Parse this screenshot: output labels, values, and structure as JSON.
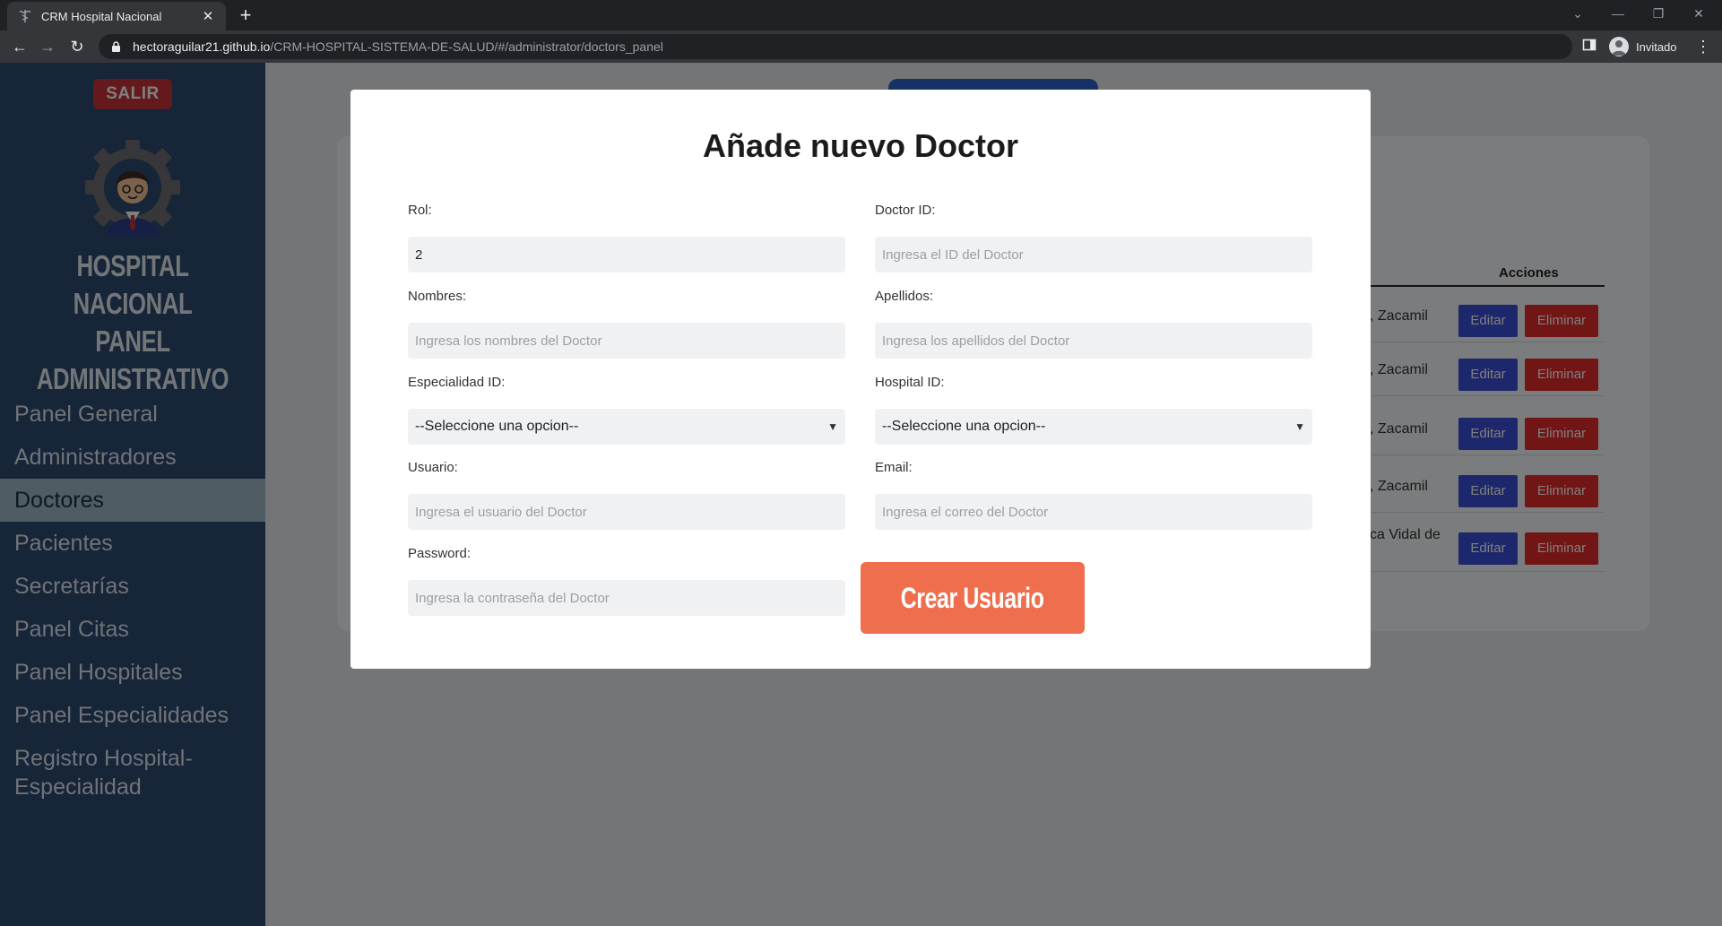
{
  "browser": {
    "tab_title": "CRM Hospital Nacional",
    "url_host": "hectoraguilar21.github.io",
    "url_path": "/CRM-HOSPITAL-SISTEMA-DE-SALUD/#/administrator/doctors_panel",
    "profile_label": "Invitado"
  },
  "sidebar": {
    "logout_label": "SALIR",
    "brand_line1": "HOSPITAL NACIONAL",
    "brand_line2": "PANEL",
    "brand_line3": "ADMINISTRATIVO",
    "items": [
      {
        "label": "Panel General"
      },
      {
        "label": "Administradores"
      },
      {
        "label": "Doctores"
      },
      {
        "label": "Pacientes"
      },
      {
        "label": "Secretarías"
      },
      {
        "label": "Panel Citas"
      },
      {
        "label": "Panel Hospitales"
      },
      {
        "label": "Panel Especialidades"
      },
      {
        "label": "Registro Hospital-Especialidad"
      }
    ]
  },
  "table": {
    "actions_header": "Acciones",
    "rows": [
      {
        "text": ", Zacamil",
        "edit": "Editar",
        "delete": "Eliminar"
      },
      {
        "text": ", Zacamil",
        "edit": "Editar",
        "delete": "Eliminar"
      },
      {
        "text": ", Zacamil",
        "edit": "Editar",
        "delete": "Eliminar"
      },
      {
        "text": ", Zacamil",
        "edit": "Editar",
        "delete": "Eliminar"
      },
      {
        "text": "ca Vidal de",
        "edit": "Editar",
        "delete": "Eliminar"
      }
    ]
  },
  "modal": {
    "title": "Añade nuevo Doctor",
    "fields": {
      "rol": {
        "label": "Rol:",
        "value": "2"
      },
      "doctor_id": {
        "label": "Doctor ID:",
        "placeholder": "Ingresa el ID del Doctor"
      },
      "nombres": {
        "label": "Nombres:",
        "placeholder": "Ingresa los nombres del Doctor"
      },
      "apellidos": {
        "label": "Apellidos:",
        "placeholder": "Ingresa los apellidos del Doctor"
      },
      "especialidad": {
        "label": "Especialidad ID:",
        "selected": "--Seleccione una opcion--"
      },
      "hospital": {
        "label": "Hospital ID:",
        "selected": "--Seleccione una opcion--"
      },
      "usuario": {
        "label": "Usuario:",
        "placeholder": "Ingresa el usuario del Doctor"
      },
      "email": {
        "label": "Email:",
        "placeholder": "Ingresa el correo del Doctor"
      },
      "password": {
        "label": "Password:",
        "placeholder": "Ingresa la contraseña del Doctor"
      }
    },
    "submit_label": "Crear Usuario"
  },
  "colors": {
    "sidebar_bg": "#2c4a6e",
    "active_item": "#9fb8c3",
    "logout": "#c8343a",
    "edit_button": "#3b4fd6",
    "delete_button": "#e22a2a",
    "submit_button": "#ef6e4e"
  }
}
